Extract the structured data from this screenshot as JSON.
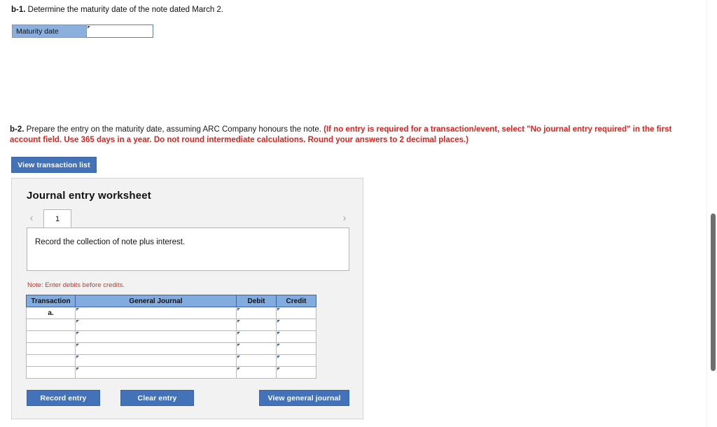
{
  "b1": {
    "label": "b-1.",
    "prompt": "Determine the maturity date of the note dated March 2.",
    "maturity_label": "Maturity date",
    "maturity_value": "",
    "maturity_placeholder": ""
  },
  "b2": {
    "label": "b-2.",
    "prompt": "Prepare the entry on the maturity date, assuming ARC Company honours the note.",
    "red_instruction": "(If no entry is required for a transaction/event, select \"No journal entry required\" in the first account field. Use 365 days in a year. Do not round intermediate calculations. Round your answers to 2 decimal places.)",
    "view_transaction_list_label": "View transaction list"
  },
  "worksheet": {
    "title": "Journal entry worksheet",
    "prev_chevron": "‹",
    "next_chevron": "›",
    "tabs": [
      {
        "label": "1",
        "active": true
      }
    ],
    "description": "Record the collection of note plus interest.",
    "debits_note": "Note: Enter debits before credits.",
    "table": {
      "columns": [
        "Transaction",
        "General Journal",
        "Debit",
        "Credit"
      ],
      "rows": [
        {
          "transaction": "a.",
          "general_journal": "",
          "debit": "",
          "credit": ""
        },
        {
          "transaction": "",
          "general_journal": "",
          "debit": "",
          "credit": ""
        },
        {
          "transaction": "",
          "general_journal": "",
          "debit": "",
          "credit": ""
        },
        {
          "transaction": "",
          "general_journal": "",
          "debit": "",
          "credit": ""
        },
        {
          "transaction": "",
          "general_journal": "",
          "debit": "",
          "credit": ""
        },
        {
          "transaction": "",
          "general_journal": "",
          "debit": "",
          "credit": ""
        }
      ]
    },
    "buttons": {
      "record_entry": "Record entry",
      "clear_entry": "Clear entry",
      "view_general_journal": "View general journal"
    }
  },
  "colors": {
    "button_blue": "#4472b8",
    "header_blue": "#82ace0",
    "label_blue": "#8cb0dd",
    "red": "#d9241f",
    "panel_gray": "#f2f2f2"
  }
}
